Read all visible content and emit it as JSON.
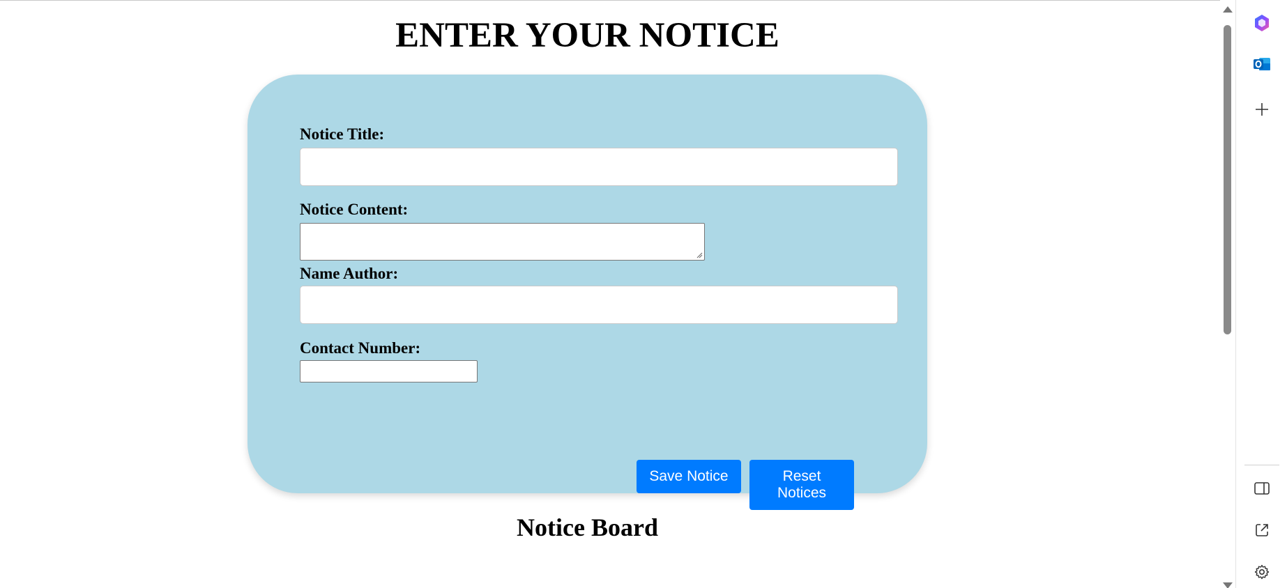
{
  "page": {
    "title": "ENTER YOUR NOTICE"
  },
  "form": {
    "notice_title_label": "Notice Title:",
    "notice_content_label": "Notice Content:",
    "name_author_label": "Name Author:",
    "contact_number_label": "Contact Number:",
    "notice_title_value": "",
    "notice_content_value": "",
    "name_author_value": "",
    "contact_number_value": ""
  },
  "buttons": {
    "save_label": "Save Notice",
    "reset_label_line1": "Reset",
    "reset_label_line2": "Notices"
  },
  "board": {
    "title": "Notice Board"
  },
  "sidebar": {
    "items": [
      {
        "icon": "copilot-icon"
      },
      {
        "icon": "outlook-icon"
      },
      {
        "icon": "add-icon"
      },
      {
        "icon": "sidebar-toggle-icon"
      },
      {
        "icon": "open-external-icon"
      },
      {
        "icon": "settings-icon"
      }
    ]
  },
  "colors": {
    "card_background": "#add8e6",
    "button_background": "#007bff",
    "button_text": "#ffffff"
  }
}
